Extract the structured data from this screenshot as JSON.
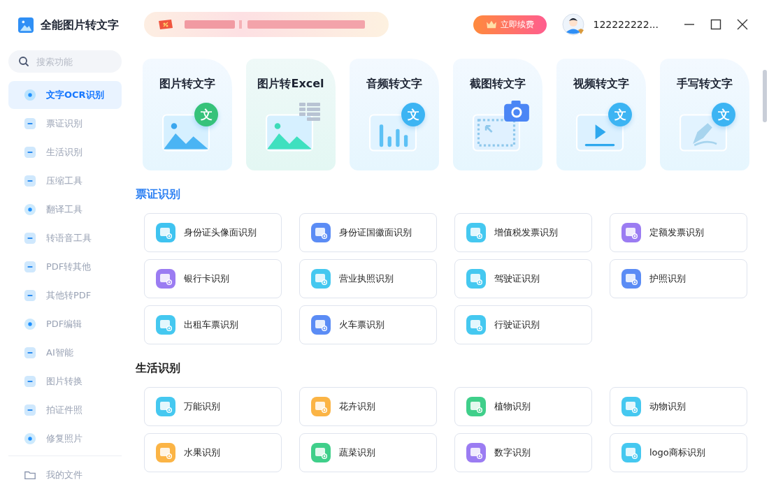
{
  "app": {
    "title": "全能图片转文字"
  },
  "renew_button": {
    "label": "立即续费"
  },
  "user": {
    "name": "122222222..."
  },
  "search": {
    "placeholder": "搜索功能"
  },
  "sidebar": {
    "items": [
      {
        "label": "文字OCR识别",
        "selected": true,
        "kind": "circle"
      },
      {
        "label": "票证识别",
        "selected": false,
        "kind": "tile"
      },
      {
        "label": "生活识别",
        "selected": false,
        "kind": "tile"
      },
      {
        "label": "压缩工具",
        "selected": false,
        "kind": "tile"
      },
      {
        "label": "翻译工具",
        "selected": false,
        "kind": "circle"
      },
      {
        "label": "转语音工具",
        "selected": false,
        "kind": "tile"
      },
      {
        "label": "PDF转其他",
        "selected": false,
        "kind": "tile"
      },
      {
        "label": "其他转PDF",
        "selected": false,
        "kind": "tile"
      },
      {
        "label": "PDF编辑",
        "selected": false,
        "kind": "circle"
      },
      {
        "label": "AI智能",
        "selected": false,
        "kind": "tile"
      },
      {
        "label": "图片转换",
        "selected": false,
        "kind": "tile"
      },
      {
        "label": "拍证件照",
        "selected": false,
        "kind": "tile"
      },
      {
        "label": "修复照片",
        "selected": false,
        "kind": "circle"
      }
    ],
    "files": {
      "label": "我的文件"
    }
  },
  "feature_cards": [
    {
      "title": "图片转文字",
      "kind": "image",
      "badge": "文"
    },
    {
      "title": "图片转Excel",
      "kind": "excel"
    },
    {
      "title": "音频转文字",
      "kind": "audio",
      "badge": "文"
    },
    {
      "title": "截图转文字",
      "kind": "screenshot"
    },
    {
      "title": "视频转文字",
      "kind": "video",
      "badge": "文"
    },
    {
      "title": "手写转文字",
      "kind": "handwriting",
      "badge": "文"
    }
  ],
  "sections": [
    {
      "title": "票证识别",
      "selected": true,
      "tools": [
        {
          "label": "身份证头像面识别",
          "color": "#3fc3f0"
        },
        {
          "label": "身份证国徽面识别",
          "color": "#5b8cf5"
        },
        {
          "label": "增值税发票识别",
          "color": "#45c8f0"
        },
        {
          "label": "定额发票识别",
          "color": "#9b7cf2"
        },
        {
          "label": "银行卡识别",
          "color": "#9b7cf2"
        },
        {
          "label": "营业执照识别",
          "color": "#45c8f0"
        },
        {
          "label": "驾驶证识别",
          "color": "#45c8f0"
        },
        {
          "label": "护照识别",
          "color": "#5b8cf5"
        },
        {
          "label": "出租车票识别",
          "color": "#45c8f0"
        },
        {
          "label": "火车票识别",
          "color": "#5b8cf5"
        },
        {
          "label": "行驶证识别",
          "color": "#45c8f0"
        }
      ]
    },
    {
      "title": "生活识别",
      "selected": false,
      "tools": [
        {
          "label": "万能识别",
          "color": "#45c8f0"
        },
        {
          "label": "花卉识别",
          "color": "#fbb445"
        },
        {
          "label": "植物识别",
          "color": "#3fcf8a"
        },
        {
          "label": "动物识别",
          "color": "#45c8f0"
        },
        {
          "label": "水果识别",
          "color": "#fbb445"
        },
        {
          "label": "蔬菜识别",
          "color": "#3fcf8a"
        },
        {
          "label": "数字识别",
          "color": "#9b7cf2"
        },
        {
          "label": "logo商标识别",
          "color": "#45c8f0"
        }
      ]
    }
  ]
}
